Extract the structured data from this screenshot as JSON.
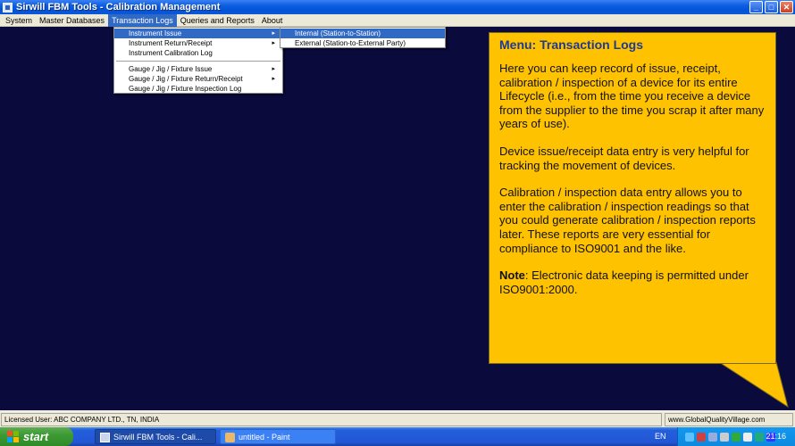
{
  "window": {
    "title": "Sirwill FBM Tools - Calibration Management",
    "buttons": {
      "minimize": "_",
      "maximize": "□",
      "close": "✕"
    }
  },
  "menubar": {
    "items": [
      {
        "label": "System"
      },
      {
        "label": "Master Databases"
      },
      {
        "label": "Transaction Logs",
        "active": true
      },
      {
        "label": "Queries and Reports"
      },
      {
        "label": "About"
      }
    ]
  },
  "dropdown": {
    "items": [
      {
        "label": "Instrument Issue",
        "arrow": "▸"
      },
      {
        "label": "Instrument Return/Receipt",
        "arrow": "▸"
      },
      {
        "label": "Instrument Calibration Log"
      },
      {
        "label": "Gauge / Jig / Fixture Issue",
        "arrow": "▸"
      },
      {
        "label": "Gauge / Jig / Fixture Return/Receipt",
        "arrow": "▸"
      },
      {
        "label": "Gauge / Jig / Fixture Inspection Log"
      }
    ]
  },
  "submenu": {
    "items": [
      {
        "label": "Internal (Station-to-Station)"
      },
      {
        "label": "External (Station-to-External Party)"
      }
    ]
  },
  "callout": {
    "heading": "Menu: Transaction Logs",
    "p1": "Here you can keep record of issue, receipt, calibration / inspection of a device for its entire Lifecycle (i.e., from the time you receive a device from the supplier to the time you scrap it  after many years of use).",
    "p2": "Device issue/receipt data entry is very helpful for tracking the movement of devices.",
    "p3": "Calibration / inspection data entry allows you to enter the calibration / inspection  readings so that you could generate calibration / inspection reports later. These reports are very essential for compliance to ISO9001 and the like.",
    "note_label": "Note",
    "note_text": ": Electronic data keeping is permitted under ISO9001:2000."
  },
  "statusbar": {
    "left": "Licensed User: ABC COMPANY LTD., TN, INDIA",
    "right": "www.GlobalQualityVillage.com"
  },
  "taskbar": {
    "start_label": "start",
    "tasks": [
      {
        "label": "Sirwill FBM Tools - Cali..."
      },
      {
        "label": "untitled - Paint"
      }
    ],
    "language": "EN",
    "clock": "21:16"
  },
  "colors": {
    "desktop_bg": "#0a0a3d",
    "callout_bg": "#ffc200",
    "callout_heading": "#1f3a93",
    "menu_highlight": "#316ac5"
  }
}
